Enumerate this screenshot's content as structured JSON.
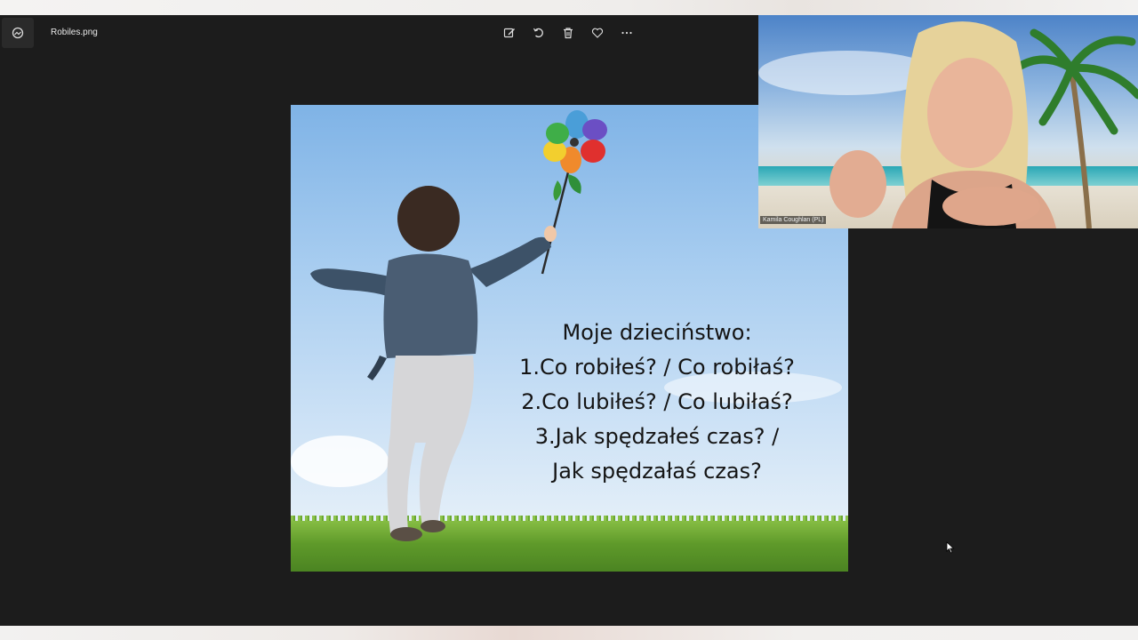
{
  "viewer": {
    "filename": "Robiles.png",
    "toolbar": [
      {
        "id": "edit",
        "icon": "edit-image-icon"
      },
      {
        "id": "rotate",
        "icon": "rotate-icon"
      },
      {
        "id": "delete",
        "icon": "trash-icon"
      },
      {
        "id": "favorite",
        "icon": "heart-icon"
      },
      {
        "id": "more",
        "icon": "more-options-icon"
      }
    ]
  },
  "slide": {
    "lines": [
      "Moje dzieciństwo:",
      "1.Co robiłeś? /  Co robiłaś?",
      "2.Co lubiłeś? / Co lubiłaś?",
      "3.Jak spędzałeś czas? /",
      "Jak spędzałaś czas?"
    ]
  },
  "video": {
    "participant_name": "Kamila Coughlan (PL)"
  }
}
